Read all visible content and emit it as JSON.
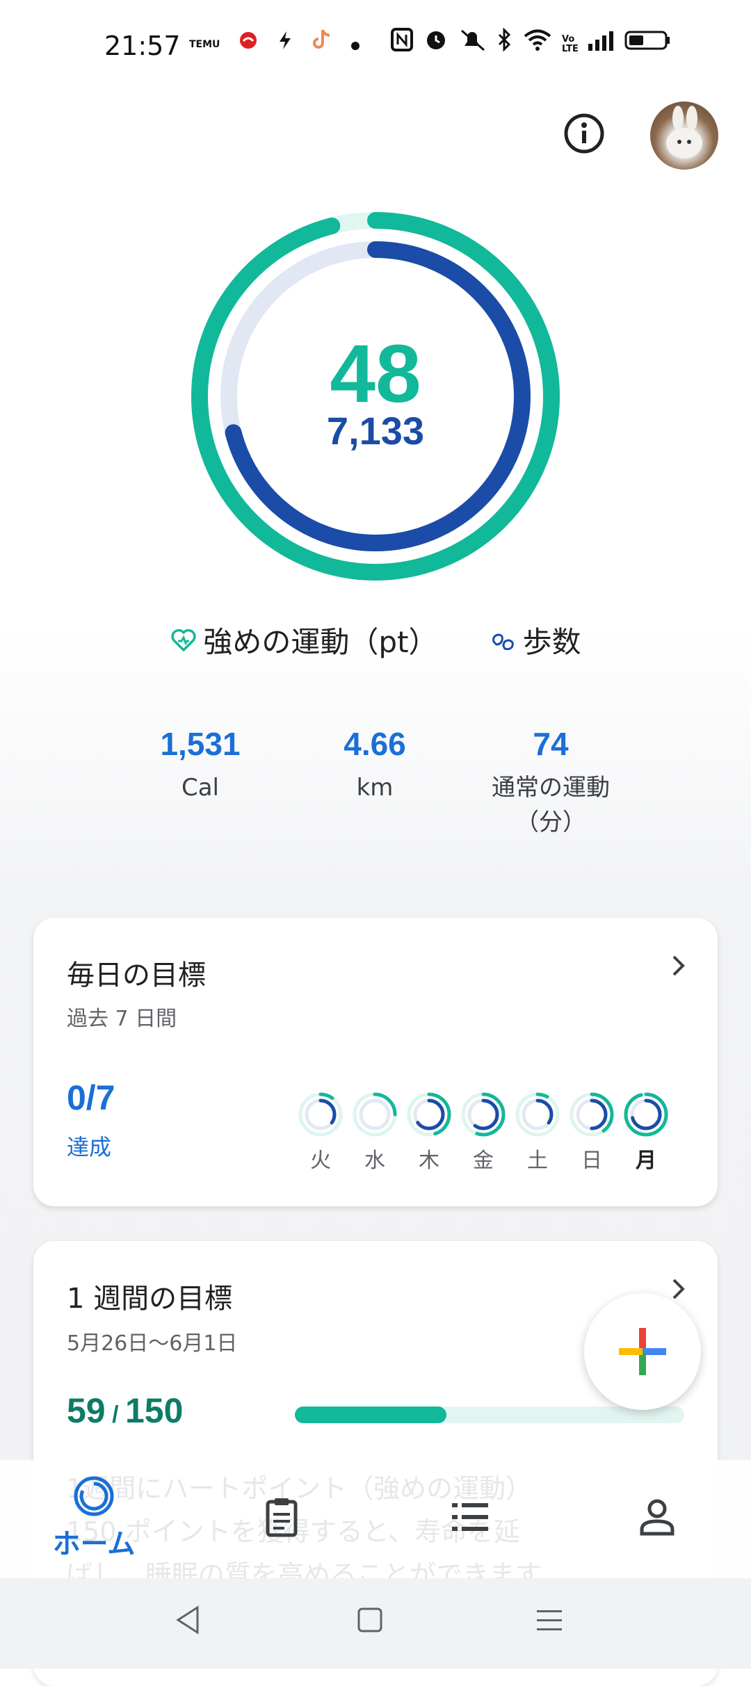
{
  "status_bar": {
    "time": "21:57",
    "icons": [
      "temu-icon",
      "app-icon",
      "bolt-icon",
      "tiktok-icon",
      "dot-icon",
      "nfc-icon",
      "alarm-icon",
      "mute-icon",
      "bluetooth-icon",
      "wifi-icon",
      "volte-icon",
      "signal-icon",
      "battery-icon"
    ]
  },
  "summary": {
    "heart_points": "48",
    "steps": "7,133",
    "heart_points_fraction": 0.96,
    "steps_fraction": 0.71
  },
  "legend": {
    "heart_points_label": "強めの運動（pt）",
    "steps_label": "歩数"
  },
  "stats": [
    {
      "value": "1,531",
      "label": "Cal"
    },
    {
      "value": "4.66",
      "label": "km"
    },
    {
      "value": "74",
      "label": "通常の運動",
      "label2": "（分）"
    }
  ],
  "daily_goal": {
    "title": "毎日の目標",
    "subtitle": "過去 7 日間",
    "count": "0/7",
    "count_label": "達成",
    "days": [
      {
        "label": "火",
        "hp": 0.1,
        "steps": 0.35
      },
      {
        "label": "水",
        "hp": 0.25,
        "steps": 0.0
      },
      {
        "label": "木",
        "hp": 0.45,
        "steps": 0.65
      },
      {
        "label": "金",
        "hp": 0.55,
        "steps": 0.6
      },
      {
        "label": "土",
        "hp": 0.08,
        "steps": 0.35
      },
      {
        "label": "日",
        "hp": 0.4,
        "steps": 0.5
      },
      {
        "label": "月",
        "hp": 0.96,
        "steps": 0.71
      }
    ]
  },
  "weekly_goal": {
    "title": "1 週間の目標",
    "date_range": "5月26日〜6月1日",
    "current": "59",
    "target": "150",
    "progress": 0.39
  },
  "bottom_nav": {
    "home_label": "ホーム",
    "ghost_text": "1週間にハートポイント（強めの運動）\n150 ポイントを獲得すると、寿命を延\nばし、睡眠の質を高めることができます"
  },
  "colors": {
    "heart_points": "#12b89a",
    "steps": "#1a4ca8",
    "accent_blue": "#1b6fd6"
  }
}
